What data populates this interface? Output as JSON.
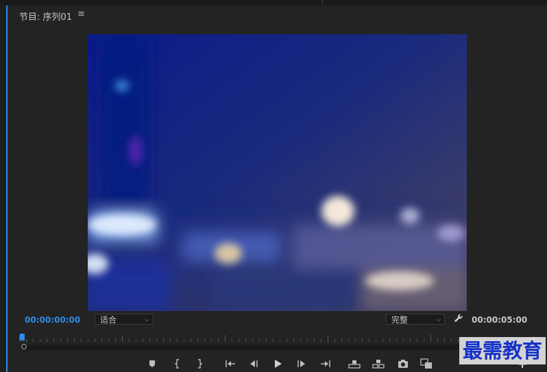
{
  "panel": {
    "title": "节目: 序列01",
    "menu_icon": "hamburger-menu-icon"
  },
  "timecode": {
    "current": "00:00:00:00",
    "duration": "00:00:05:00"
  },
  "fit_dropdown": {
    "selected": "适合"
  },
  "resolution_dropdown": {
    "selected": "完整"
  },
  "playhead_position": 0,
  "transport": [
    {
      "name": "add-marker",
      "icon": "marker-icon"
    },
    {
      "name": "mark-in",
      "icon": "mark-in-icon"
    },
    {
      "name": "mark-out",
      "icon": "mark-out-icon"
    },
    {
      "name": "go-to-in",
      "icon": "go-to-in-icon"
    },
    {
      "name": "step-back",
      "icon": "step-back-icon"
    },
    {
      "name": "play",
      "icon": "play-icon"
    },
    {
      "name": "step-forward",
      "icon": "step-forward-icon"
    },
    {
      "name": "go-to-out",
      "icon": "go-to-out-icon"
    },
    {
      "name": "lift",
      "icon": "lift-icon"
    },
    {
      "name": "extract",
      "icon": "extract-icon"
    },
    {
      "name": "export-frame",
      "icon": "camera-icon"
    },
    {
      "name": "compare",
      "icon": "compare-icon"
    }
  ],
  "colors": {
    "accent": "#2d8ceb",
    "background": "#232323",
    "watermark": "#1431c8"
  },
  "watermark": {
    "text": "最需教育"
  }
}
